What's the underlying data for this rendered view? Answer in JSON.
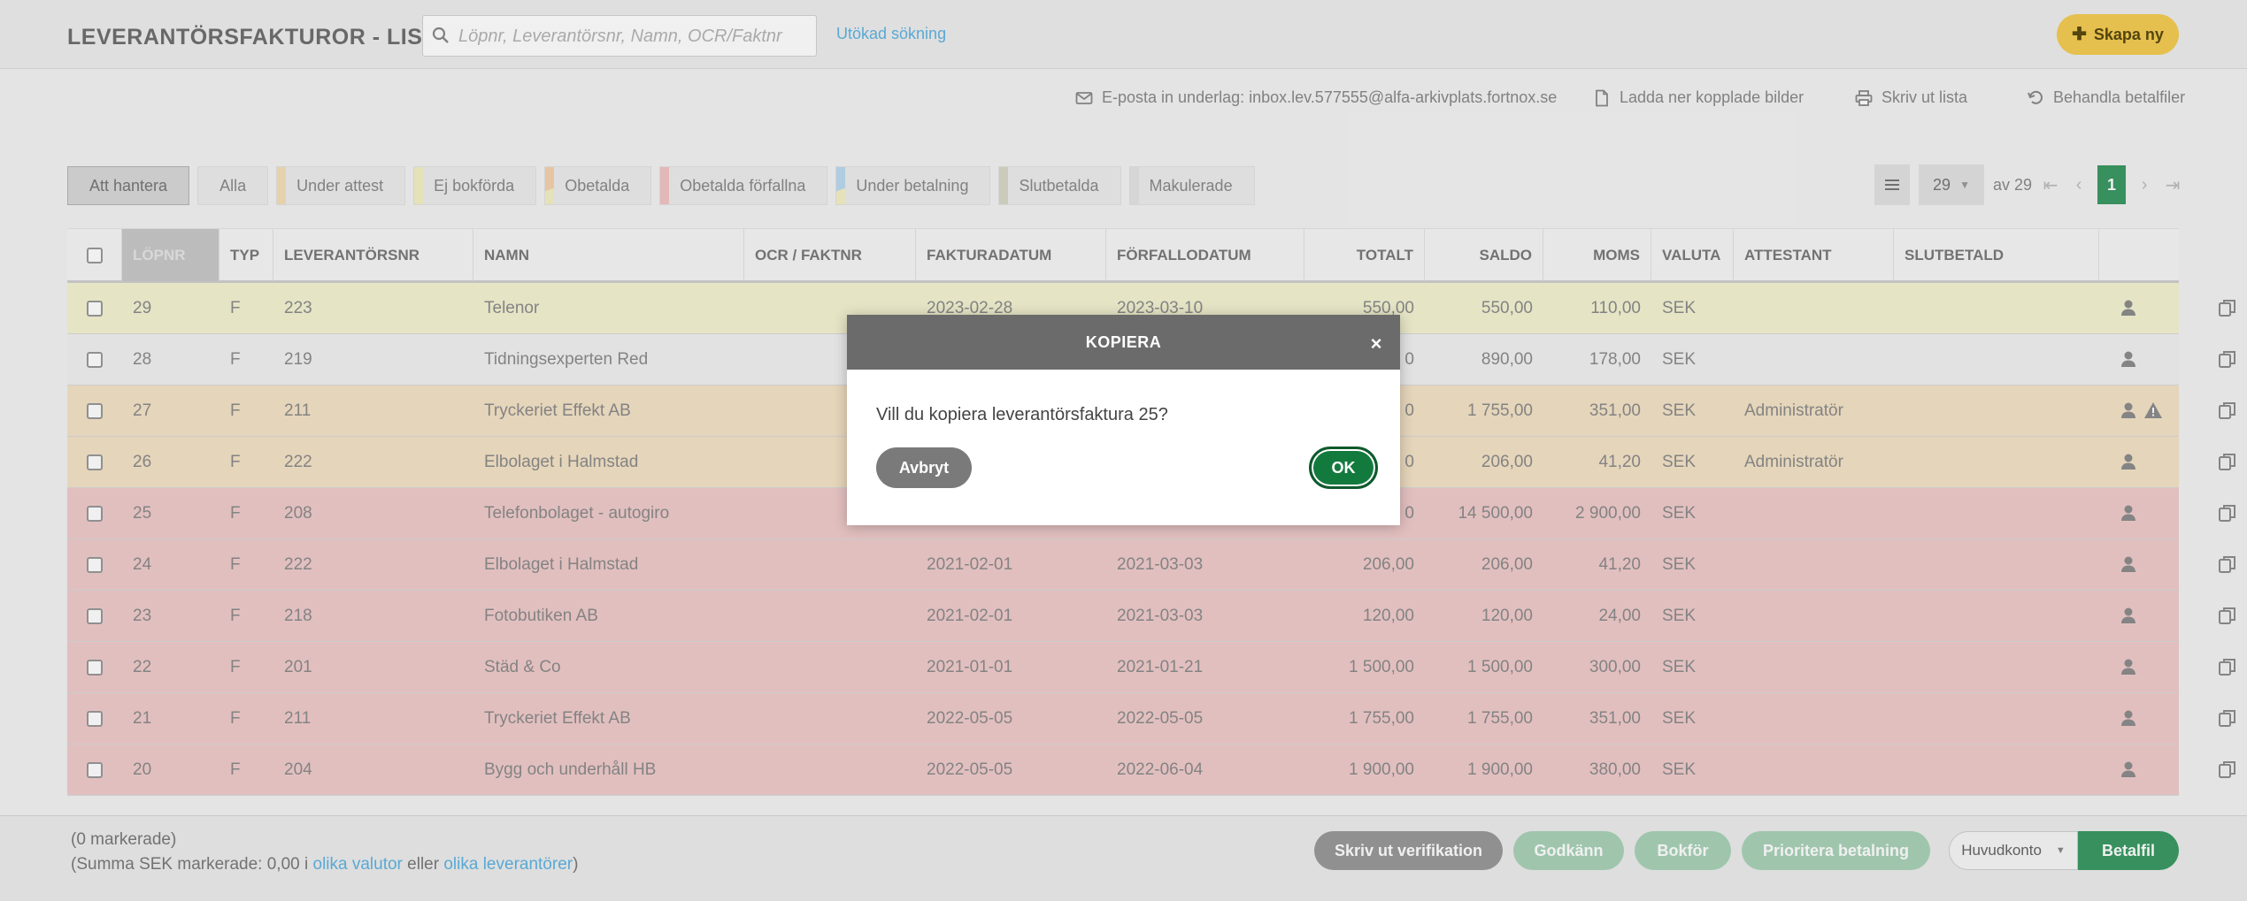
{
  "header": {
    "title": "LEVERANTÖRSFAKTUROR - LISTA",
    "search_placeholder": "Löpnr, Leverantörsnr, Namn, OCR/Faktnr",
    "extended_search": "Utökad sökning",
    "create_new": "Skapa ny"
  },
  "toolbar": {
    "email": "E-posta in underlag: inbox.lev.577555@alfa-arkivplats.fortnox.se",
    "download": "Ladda ner kopplade bilder",
    "print": "Skriv ut lista",
    "handle_payment": "Behandla betalfiler"
  },
  "filters": [
    {
      "label": "Att hantera",
      "color": ""
    },
    {
      "label": "Alla",
      "color": ""
    },
    {
      "label": "Under attest",
      "color": "#f5dfb8"
    },
    {
      "label": "Ej bokförda",
      "color": "#f4f1c6"
    },
    {
      "label": "Obetalda",
      "color": "#f5d3ad"
    },
    {
      "label": "Obetalda förfallna",
      "color": "#f2c4c4"
    },
    {
      "label": "Under betalning",
      "color": "#bcd9ef"
    },
    {
      "label": "Slutbetalda",
      "color": "#d8d8c8"
    },
    {
      "label": "Makulerade",
      "color": "#e4e4e4"
    }
  ],
  "pager": {
    "per_page": "29",
    "of_label": "av 29",
    "current": "1"
  },
  "columns": {
    "lopnr": "LÖPNR",
    "typ": "TYP",
    "levnr": "LEVERANTÖRSNR",
    "namn": "NAMN",
    "ocr": "OCR / FAKTNR",
    "fdatum": "FAKTURADATUM",
    "fordatum": "FÖRFALLODATUM",
    "totalt": "TOTALT",
    "saldo": "SALDO",
    "moms": "MOMS",
    "valuta": "VALUTA",
    "attestant": "ATTESTANT",
    "slutbetald": "SLUTBETALD"
  },
  "rows": [
    {
      "lopnr": "29",
      "typ": "F",
      "levnr": "223",
      "namn": "Telenor",
      "fdatum": "2023-02-28",
      "fordatum": "2023-03-10",
      "totalt": "550,00",
      "saldo": "550,00",
      "moms": "110,00",
      "valuta": "SEK",
      "attestant": "",
      "bg": "#f4f3d2",
      "warn": false
    },
    {
      "lopnr": "28",
      "typ": "F",
      "levnr": "219",
      "namn": "Tidningsexperten Red",
      "fdatum": "",
      "fordatum": "",
      "totalt": "0",
      "saldo": "890,00",
      "moms": "178,00",
      "valuta": "SEK",
      "attestant": "",
      "bg": "#f1f1f1",
      "warn": false
    },
    {
      "lopnr": "27",
      "typ": "F",
      "levnr": "211",
      "namn": "Tryckeriet Effekt AB",
      "fdatum": "",
      "fordatum": "",
      "totalt": "0",
      "saldo": "1 755,00",
      "moms": "351,00",
      "valuta": "SEK",
      "attestant": "Administratör",
      "bg": "#f4e3c6",
      "warn": true
    },
    {
      "lopnr": "26",
      "typ": "F",
      "levnr": "222",
      "namn": "Elbolaget i Halmstad",
      "fdatum": "",
      "fordatum": "",
      "totalt": "0",
      "saldo": "206,00",
      "moms": "41,20",
      "valuta": "SEK",
      "attestant": "Administratör",
      "bg": "#f4e3c6",
      "warn": false
    },
    {
      "lopnr": "25",
      "typ": "F",
      "levnr": "208",
      "namn": "Telefonbolaget - autogiro",
      "fdatum": "",
      "fordatum": "",
      "totalt": "0",
      "saldo": "14 500,00",
      "moms": "2 900,00",
      "valuta": "SEK",
      "attestant": "",
      "bg": "#f1cbcb",
      "warn": false
    },
    {
      "lopnr": "24",
      "typ": "F",
      "levnr": "222",
      "namn": "Elbolaget i Halmstad",
      "fdatum": "2021-02-01",
      "fordatum": "2021-03-03",
      "totalt": "206,00",
      "saldo": "206,00",
      "moms": "41,20",
      "valuta": "SEK",
      "attestant": "",
      "bg": "#f1cbcb",
      "warn": false
    },
    {
      "lopnr": "23",
      "typ": "F",
      "levnr": "218",
      "namn": "Fotobutiken AB",
      "fdatum": "2021-02-01",
      "fordatum": "2021-03-03",
      "totalt": "120,00",
      "saldo": "120,00",
      "moms": "24,00",
      "valuta": "SEK",
      "attestant": "",
      "bg": "#f1cbcb",
      "warn": false
    },
    {
      "lopnr": "22",
      "typ": "F",
      "levnr": "201",
      "namn": "Städ & Co",
      "fdatum": "2021-01-01",
      "fordatum": "2021-01-21",
      "totalt": "1 500,00",
      "saldo": "1 500,00",
      "moms": "300,00",
      "valuta": "SEK",
      "attestant": "",
      "bg": "#f1cbcb",
      "warn": false
    },
    {
      "lopnr": "21",
      "typ": "F",
      "levnr": "211",
      "namn": "Tryckeriet Effekt AB",
      "fdatum": "2022-05-05",
      "fordatum": "2022-05-05",
      "totalt": "1 755,00",
      "saldo": "1 755,00",
      "moms": "351,00",
      "valuta": "SEK",
      "attestant": "",
      "bg": "#f1cbcb",
      "warn": false
    },
    {
      "lopnr": "20",
      "typ": "F",
      "levnr": "204",
      "namn": "Bygg och underhåll HB",
      "fdatum": "2022-05-05",
      "fordatum": "2022-06-04",
      "totalt": "1 900,00",
      "saldo": "1 900,00",
      "moms": "380,00",
      "valuta": "SEK",
      "attestant": "",
      "bg": "#f1cbcb",
      "warn": false
    }
  ],
  "footer": {
    "selected": "(0 markerade)",
    "sum_prefix": "(Summa SEK markerade: 0,00 i",
    "link1": "olika valutor",
    "mid": "eller",
    "link2": "olika leverantörer",
    "suffix": ")",
    "btn_print": "Skriv ut verifikation",
    "btn_approve": "Godkänn",
    "btn_book": "Bokför",
    "btn_prio": "Prioritera betalning",
    "account": "Huvudkonto",
    "betalfil": "Betalfil"
  },
  "modal": {
    "title": "KOPIERA",
    "close": "×",
    "text": "Vill du kopiera leverantörsfaktura 25?",
    "cancel": "Avbryt",
    "ok": "OK"
  },
  "colors": {
    "accent_green": "#3b9a63",
    "create_yellow": "#f4cd53",
    "link_blue": "#5fb4e2"
  }
}
